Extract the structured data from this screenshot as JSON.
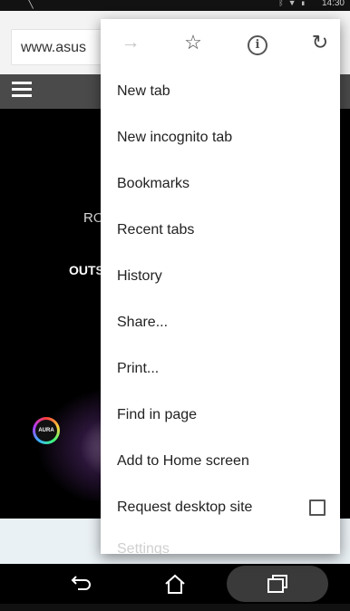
{
  "status_bar": {
    "time": "14:30",
    "icons": [
      "bluetooth-icon",
      "wifi-icon",
      "battery-icon"
    ]
  },
  "browser": {
    "url": "www.asus"
  },
  "page": {
    "text_1": "RO",
    "text_2": "OUTS",
    "aura_logo": "AURA"
  },
  "menu": {
    "top_icons": [
      "forward-icon",
      "star-icon",
      "info-icon",
      "reload-icon"
    ],
    "items": [
      {
        "label": "New tab"
      },
      {
        "label": "New incognito tab"
      },
      {
        "label": "Bookmarks"
      },
      {
        "label": "Recent tabs"
      },
      {
        "label": "History"
      },
      {
        "label": "Share..."
      },
      {
        "label": "Print..."
      },
      {
        "label": "Find in page"
      },
      {
        "label": "Add to Home screen"
      },
      {
        "label": "Request desktop site",
        "checked": false
      },
      {
        "label": "Settings"
      }
    ]
  },
  "nav": {
    "buttons": [
      "back-icon",
      "home-icon",
      "recents-icon"
    ]
  }
}
